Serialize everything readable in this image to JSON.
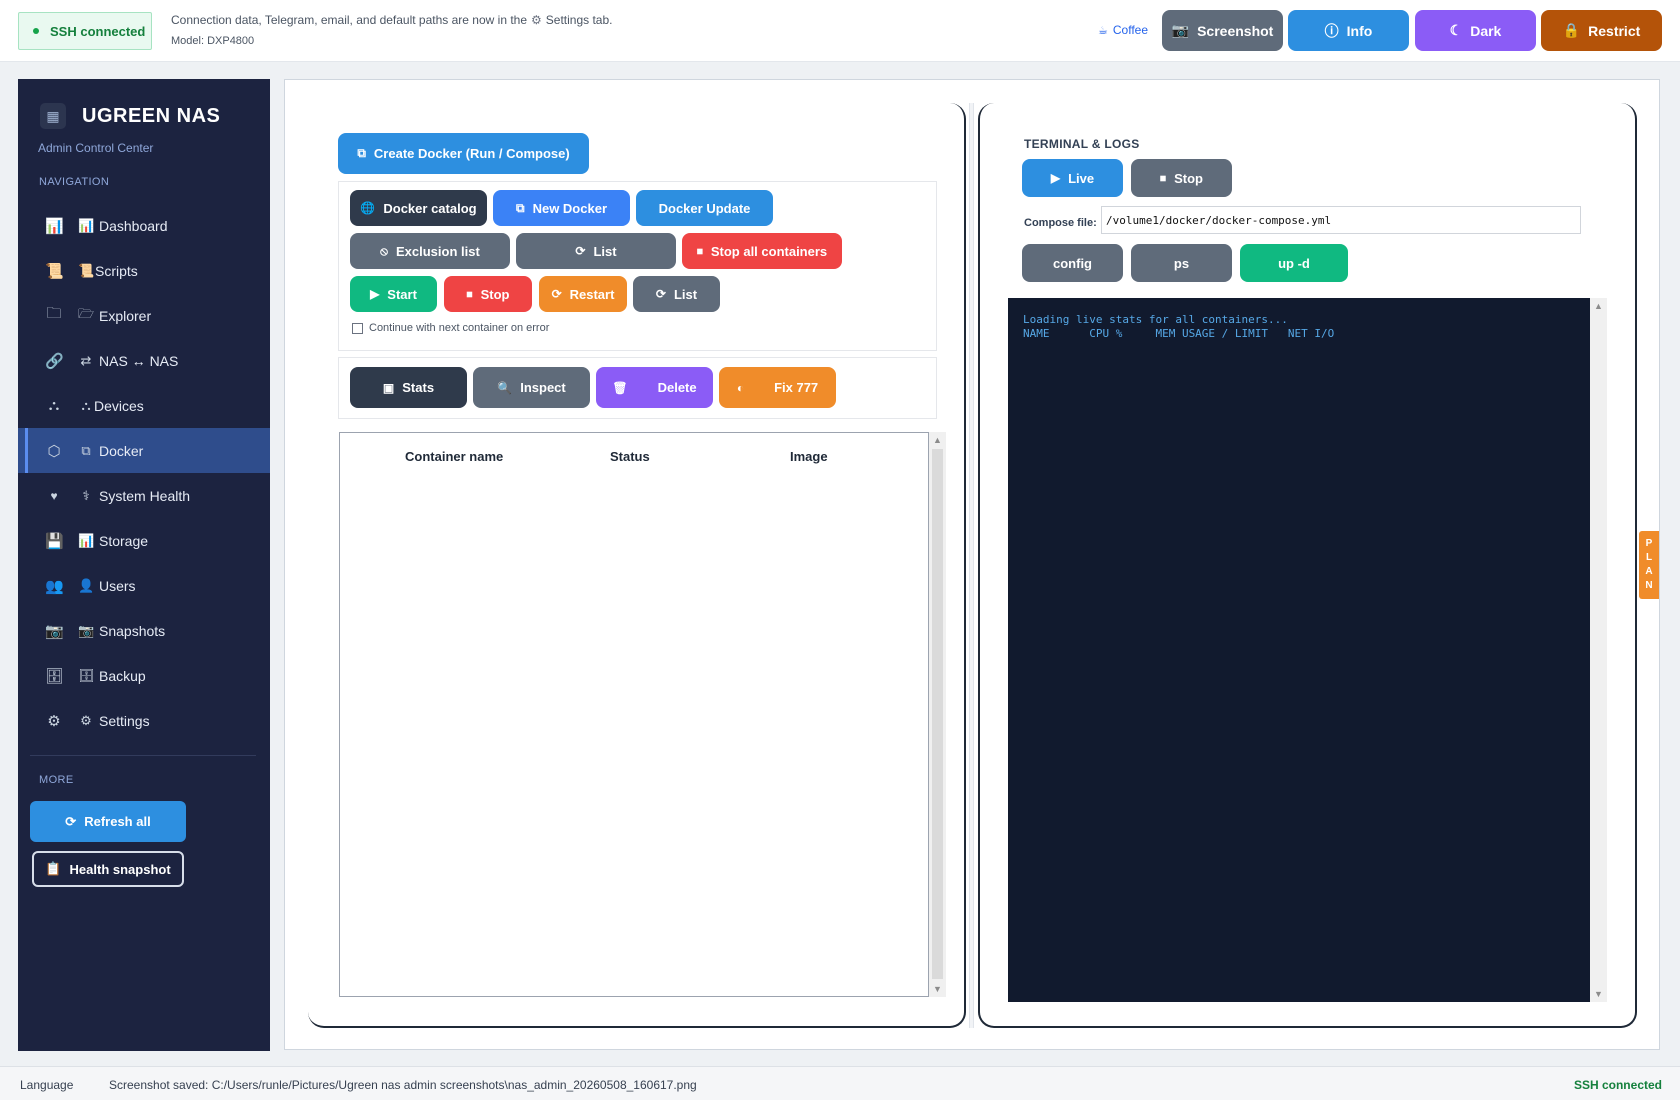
{
  "topbar": {
    "ssh_status": "SSH connected",
    "info_line": "Connection data, Telegram, email, and default paths are now in the",
    "info_line_tail": "Settings tab.",
    "model": "Model: DXP4800",
    "coffee": "Coffee",
    "buttons": {
      "screenshot": "Screenshot",
      "info": "Info",
      "dark": "Dark",
      "restrict": "Restrict"
    }
  },
  "sidebar": {
    "title": "UGREEN NAS",
    "subtitle": "Admin Control Center",
    "nav_heading": "NAVIGATION",
    "items": [
      {
        "label": "Dashboard",
        "icon": "bar-chart-icon"
      },
      {
        "label": "Scripts",
        "icon": "script-icon"
      },
      {
        "label": "Explorer",
        "icon": "folder-icon"
      },
      {
        "label": "NAS ↔ NAS",
        "icon": "link-icon"
      },
      {
        "label": "Devices",
        "icon": "network-icon"
      },
      {
        "label": "Docker",
        "icon": "cube-icon",
        "active": true
      },
      {
        "label": "System Health",
        "icon": "heart-icon"
      },
      {
        "label": "Storage",
        "icon": "disk-icon"
      },
      {
        "label": "Users",
        "icon": "users-icon"
      },
      {
        "label": "Snapshots",
        "icon": "camera-icon"
      },
      {
        "label": "Backup",
        "icon": "backup-icon"
      },
      {
        "label": "Settings",
        "icon": "gear-icon"
      }
    ],
    "more_heading": "MORE",
    "refresh_all": "Refresh all",
    "health_snapshot": "Health snapshot"
  },
  "docker": {
    "create_button": "Create Docker (Run / Compose)",
    "row1": {
      "catalog": "Docker catalog",
      "new": "New Docker",
      "update": "Docker Update"
    },
    "row2": {
      "exclusion": "Exclusion list",
      "list": "List",
      "stop_all": "Stop all containers"
    },
    "row3": {
      "start": "Start",
      "stop": "Stop",
      "restart": "Restart",
      "list": "List"
    },
    "continue_on_error": "Continue with next container on error",
    "row4": {
      "stats": "Stats",
      "inspect": "Inspect",
      "delete": "Delete",
      "fix": "Fix 777"
    },
    "table": {
      "columns": [
        "Container name",
        "Status",
        "Image"
      ],
      "rows": []
    }
  },
  "terminal": {
    "title": "TERMINAL & LOGS",
    "live": "Live",
    "stop": "Stop",
    "compose_label": "Compose file:",
    "compose_value": "/volume1/docker/docker-compose.yml",
    "cmd_config": "config",
    "cmd_ps": "ps",
    "cmd_up": "up -d",
    "output": [
      "Loading live stats for all containers...",
      "NAME      CPU %     MEM USAGE / LIMIT   NET I/O"
    ]
  },
  "plan_tab": [
    "P",
    "L",
    "A",
    "N"
  ],
  "statusbar": {
    "language": "Language",
    "saved": "Screenshot saved: C:/Users/runle/Pictures/Ugreen nas admin screenshots\\nas_admin_20260508_160617.png",
    "ssh": "SSH connected"
  },
  "colors": {
    "sidebar_bg": "#1c2340",
    "active_nav": "#2f4d8c",
    "primary_blue": "#2d8fe0",
    "dark": "#2f3a4b",
    "gray": "#5f6b7a",
    "green": "#10b981",
    "red": "#ef4444",
    "orange": "#f08c2a",
    "purple": "#8b5cf6",
    "brown": "#b45309",
    "terminal_bg": "#111a2e"
  }
}
